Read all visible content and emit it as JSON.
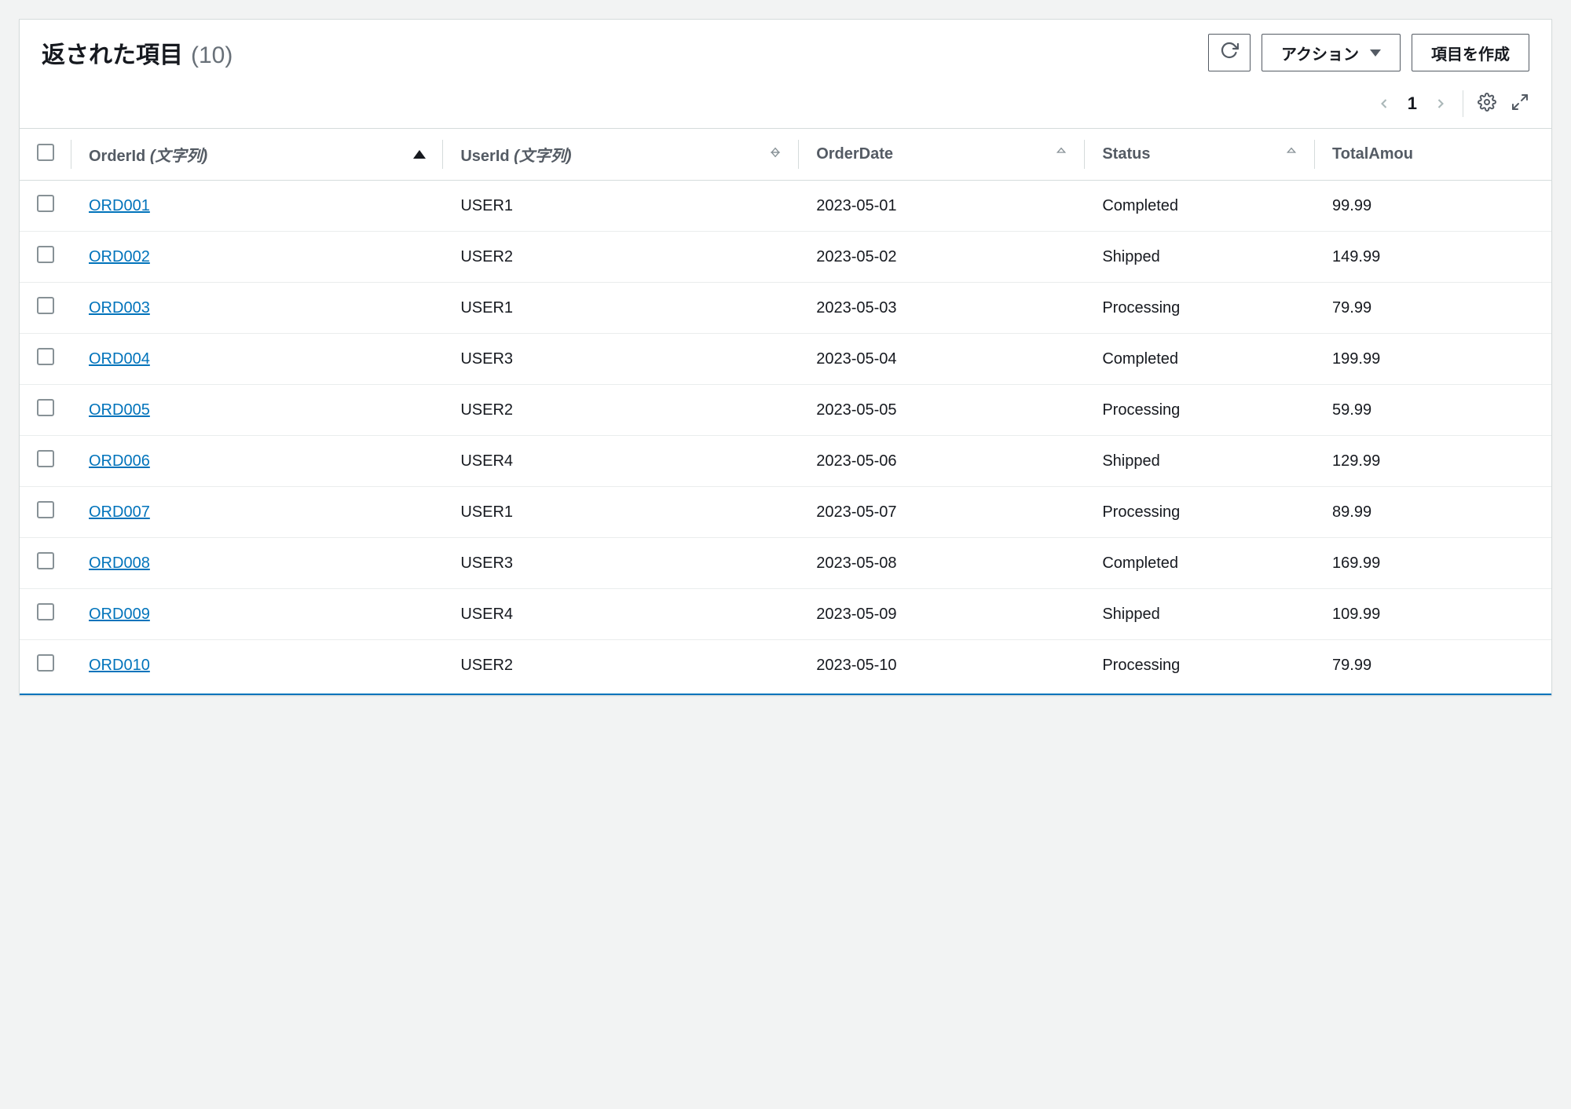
{
  "header": {
    "title": "返された項目",
    "count": "(10)",
    "refresh_aria": "Refresh",
    "actions_label": "アクション",
    "create_label": "項目を作成"
  },
  "pagination": {
    "page": "1"
  },
  "columns": {
    "orderId": {
      "label": "OrderId",
      "type": "(文字列)"
    },
    "userId": {
      "label": "UserId",
      "type": "(文字列)"
    },
    "orderDate": {
      "label": "OrderDate"
    },
    "status": {
      "label": "Status"
    },
    "totalAmount": {
      "label": "TotalAmou"
    }
  },
  "rows": [
    {
      "orderId": "ORD001",
      "userId": "USER1",
      "orderDate": "2023-05-01",
      "status": "Completed",
      "totalAmount": "99.99"
    },
    {
      "orderId": "ORD002",
      "userId": "USER2",
      "orderDate": "2023-05-02",
      "status": "Shipped",
      "totalAmount": "149.99"
    },
    {
      "orderId": "ORD003",
      "userId": "USER1",
      "orderDate": "2023-05-03",
      "status": "Processing",
      "totalAmount": "79.99"
    },
    {
      "orderId": "ORD004",
      "userId": "USER3",
      "orderDate": "2023-05-04",
      "status": "Completed",
      "totalAmount": "199.99"
    },
    {
      "orderId": "ORD005",
      "userId": "USER2",
      "orderDate": "2023-05-05",
      "status": "Processing",
      "totalAmount": "59.99"
    },
    {
      "orderId": "ORD006",
      "userId": "USER4",
      "orderDate": "2023-05-06",
      "status": "Shipped",
      "totalAmount": "129.99"
    },
    {
      "orderId": "ORD007",
      "userId": "USER1",
      "orderDate": "2023-05-07",
      "status": "Processing",
      "totalAmount": "89.99"
    },
    {
      "orderId": "ORD008",
      "userId": "USER3",
      "orderDate": "2023-05-08",
      "status": "Completed",
      "totalAmount": "169.99"
    },
    {
      "orderId": "ORD009",
      "userId": "USER4",
      "orderDate": "2023-05-09",
      "status": "Shipped",
      "totalAmount": "109.99"
    },
    {
      "orderId": "ORD010",
      "userId": "USER2",
      "orderDate": "2023-05-10",
      "status": "Processing",
      "totalAmount": "79.99"
    }
  ]
}
